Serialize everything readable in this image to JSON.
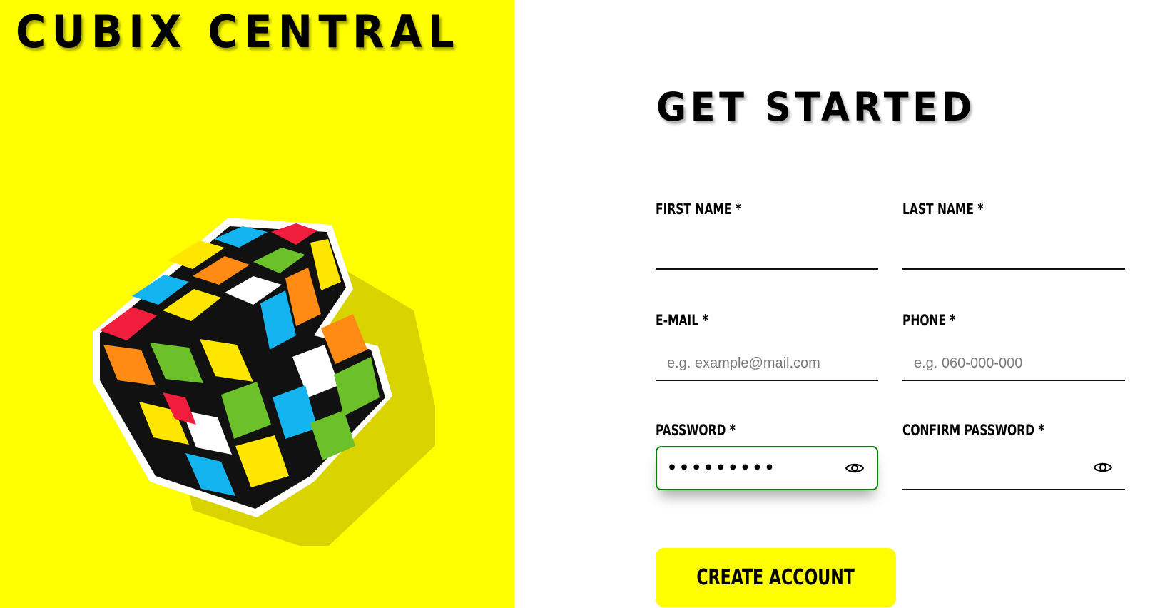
{
  "brand": {
    "title": "CUBIX CENTRAL"
  },
  "illustration": {
    "icon": "rubiks-cube-icon"
  },
  "form": {
    "title": "GET STARTED",
    "first_name": {
      "label": "FIRST NAME *",
      "value": "",
      "placeholder": ""
    },
    "last_name": {
      "label": "LAST NAME *",
      "value": "",
      "placeholder": ""
    },
    "email": {
      "label": "E-MAIL *",
      "value": "",
      "placeholder": "e.g. example@mail.com"
    },
    "phone": {
      "label": "PHONE *",
      "value": "",
      "placeholder": "e.g. 060-000-000"
    },
    "password": {
      "label": "PASSWORD *",
      "masked_value": "•••••••••",
      "icon": "eye-icon"
    },
    "confirm_password": {
      "label": "CONFIRM PASSWORD *",
      "masked_value": "",
      "icon": "eye-icon"
    },
    "submit_label": "CREATE ACCOUNT"
  },
  "colors": {
    "accent_yellow": "#ffff00",
    "focus_green": "#0a7d0a",
    "text": "#000000"
  }
}
